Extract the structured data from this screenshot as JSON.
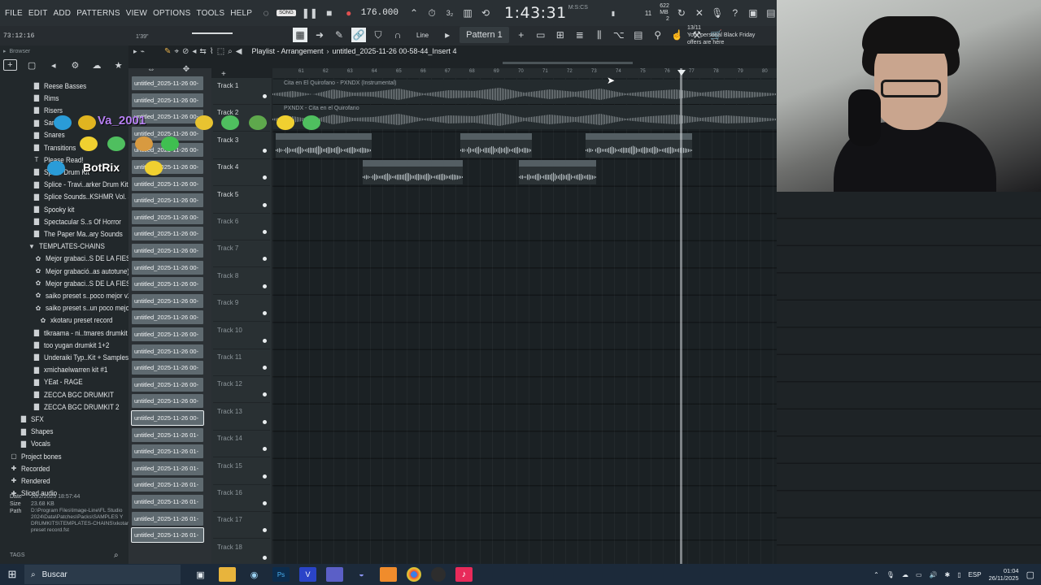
{
  "menu": [
    "FILE",
    "EDIT",
    "ADD",
    "PATTERNS",
    "VIEW",
    "OPTIONS",
    "TOOLS",
    "HELP"
  ],
  "transport": {
    "mode": "SONG",
    "tempo": "176.000",
    "time": "1:43:31",
    "time_unit": "M:S:CS",
    "cpu_label": "622 MB",
    "cpu_sub": "2",
    "voices": "11",
    "elapsed": "73:12:16",
    "hint": "1'39\""
  },
  "toolbar": {
    "line_label": "Line",
    "pattern_label": "Pattern 1"
  },
  "promo": {
    "date": "13/11",
    "text": "Your personal Black Friday offers are here"
  },
  "browser": {
    "title": "Browser",
    "items": [
      {
        "label": "Reese Basses",
        "icon": "folder"
      },
      {
        "label": "Rims",
        "icon": "folder"
      },
      {
        "label": "Risers",
        "icon": "folder"
      },
      {
        "label": "Samples",
        "icon": "folder"
      },
      {
        "label": "Snares",
        "icon": "folder"
      },
      {
        "label": "Transitions",
        "icon": "folder"
      },
      {
        "label": "Please Read!",
        "icon": "text"
      },
      {
        "label": "Splice Drum Kit",
        "icon": "folder"
      },
      {
        "label": "Splice - Travi..arker Drum Kit",
        "icon": "folder"
      },
      {
        "label": "Splice Sounds..KSHMR Vol. 3",
        "icon": "folder"
      },
      {
        "label": "Spooky kit",
        "icon": "folder"
      },
      {
        "label": "Spectacular S..s Of Horror",
        "icon": "folder"
      },
      {
        "label": "The Paper Ma..ary Sounds",
        "icon": "folder"
      },
      {
        "label": "TEMPLATES-CHAINS",
        "icon": "folder-open"
      },
      {
        "label": "Mejor grabaci..S DE LA FIESTA",
        "icon": "preset"
      },
      {
        "label": "Mejor grabació..as autotune)",
        "icon": "preset"
      },
      {
        "label": "Mejor grabaci..S DE LA FIESTA",
        "icon": "preset"
      },
      {
        "label": "saiko preset s..poco mejor v2",
        "icon": "preset"
      },
      {
        "label": "saiko preset s..un poco mejor",
        "icon": "preset"
      },
      {
        "label": "xkotaru preset record",
        "icon": "preset"
      },
      {
        "label": "tlkraama - ni..tmares drumkit",
        "icon": "folder"
      },
      {
        "label": "too yugan drumkit 1+2",
        "icon": "folder"
      },
      {
        "label": "Underaiki Typ..Kit + Samples",
        "icon": "folder"
      },
      {
        "label": "xmichaelwarren kit #1",
        "icon": "folder"
      },
      {
        "label": "YEat - RAGE",
        "icon": "folder"
      },
      {
        "label": "ZECCA BGC DRUMKIT",
        "icon": "folder"
      },
      {
        "label": "ZECCA BGC DRUMKIT 2",
        "icon": "folder"
      },
      {
        "label": "SFX",
        "icon": "folder"
      },
      {
        "label": "Shapes",
        "icon": "folder"
      },
      {
        "label": "Vocals",
        "icon": "folder"
      },
      {
        "label": "Project bones",
        "icon": "box"
      },
      {
        "label": "Recorded",
        "icon": "plus"
      },
      {
        "label": "Rendered",
        "icon": "plus"
      },
      {
        "label": "Sliced audio",
        "icon": "plus"
      }
    ],
    "info": {
      "date_label": "Date",
      "date": "26/2/2025 18:57:44",
      "size_label": "Size",
      "size": "23.68 KB",
      "path_label": "Path",
      "path": "D:\\Program Files\\Image-Line\\FL Studio 2024\\Data\\Patches\\Packs\\SAMPLES Y DRUMKITS\\TEMPLATES-CHAINS\\xkotaru preset record.fst"
    },
    "tags_label": "TAGS"
  },
  "clips_column": {
    "items": [
      "untitled_2025-11-26 00-",
      "untitled_2025-11-26 00-",
      "untitled_2025-11-26 00-",
      "untitled_2025-11-26 00-",
      "untitled_2025-11-26 00-",
      "untitled_2025-11-26 00-",
      "untitled_2025-11-26 00-",
      "untitled_2025-11-26 00-",
      "untitled_2025-11-26 00-",
      "untitled_2025-11-26 00-",
      "untitled_2025-11-26 00-",
      "untitled_2025-11-26 00-",
      "untitled_2025-11-26 00-",
      "untitled_2025-11-26 00-",
      "untitled_2025-11-26 00-",
      "untitled_2025-11-26 00-",
      "untitled_2025-11-26 00-",
      "untitled_2025-11-26 00-",
      "untitled_2025-11-26 00-",
      "untitled_2025-11-26 00-",
      "untitled_2025-11-26 00-",
      "untitled_2025-11-26 01-",
      "untitled_2025-11-26 01-",
      "untitled_2025-11-26 01-",
      "untitled_2025-11-26 01-",
      "untitled_2025-11-26 01-",
      "untitled_2025-11-26 01-",
      "untitled_2025-11-26 01-"
    ]
  },
  "playlist": {
    "title": "Playlist - Arrangement",
    "pattern": "untitled_2025-11-26 00-58-44_Insert 4",
    "ruler": [
      "61",
      "62",
      "63",
      "64",
      "65",
      "66",
      "67",
      "68",
      "69",
      "70",
      "71",
      "72",
      "73",
      "74",
      "75",
      "76",
      "77",
      "78",
      "79",
      "80"
    ],
    "tracks": [
      "Track 1",
      "Track 2",
      "Track 3",
      "Track 4",
      "Track 5",
      "Track 6",
      "Track 7",
      "Track 8",
      "Track 9",
      "Track 10",
      "Track 11",
      "Track 12",
      "Track 13",
      "Track 14",
      "Track 15",
      "Track 16",
      "Track 17",
      "Track 18"
    ],
    "clips": {
      "t1": "Cita en El Quirofano - PXNDX (Instrumental)",
      "t2": "PXNDX - Cita en el Quirofano",
      "t3a": "untitled_2025-11...1-03-53_Insert 4",
      "t3b": "untitled_202...44_Insert 4",
      "t3c": "untitled_2025-11-26 00-59-51_Insert 4",
      "t4a": "untitled_2025-11-...0-58-03_Insert 4",
      "t4b": "untitled_2025...-26_Insert 4"
    }
  },
  "overlay": {
    "user": "Va_2001",
    "bot": "BotRix"
  },
  "taskbar": {
    "search_placeholder": "Buscar",
    "lang": "ESP",
    "time": "01:04",
    "date": "26/11/2025"
  }
}
